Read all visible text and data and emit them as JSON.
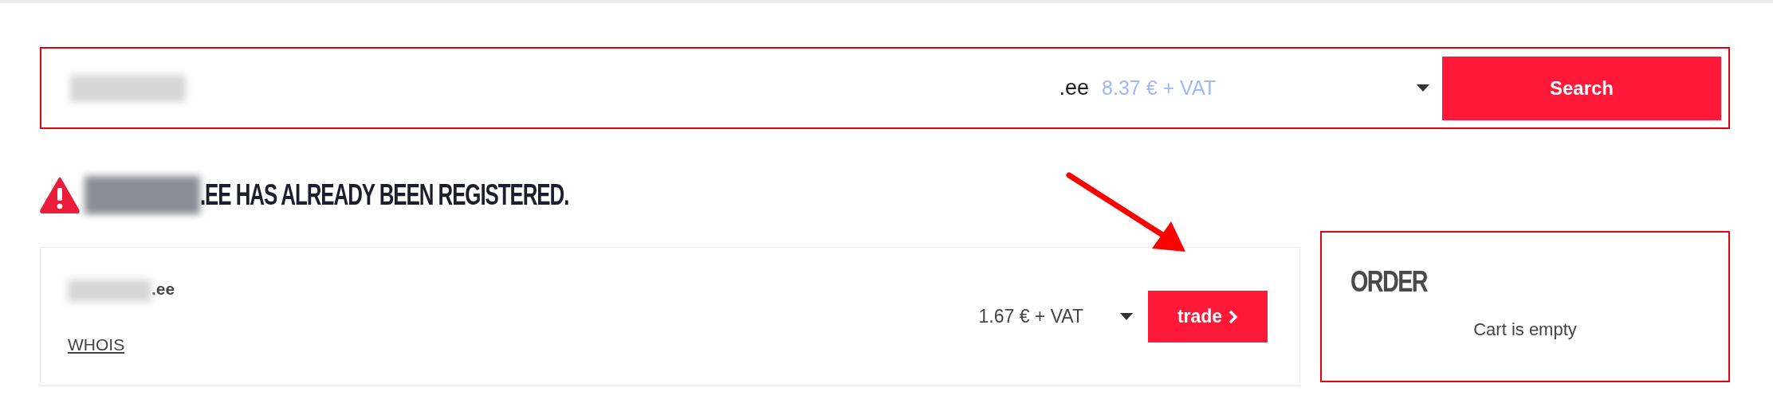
{
  "search": {
    "tld": ".ee",
    "price": "8.37 € + VAT",
    "button": "Search"
  },
  "alert": {
    "message": ".EE HAS ALREADY BEEN REGISTERED."
  },
  "results": [
    {
      "domain_suffix": ".ee",
      "whois": "WHOIS",
      "price": "1.67 € + VAT",
      "button": "trade"
    }
  ],
  "order": {
    "title": "ORDER",
    "status": "Cart is empty"
  }
}
